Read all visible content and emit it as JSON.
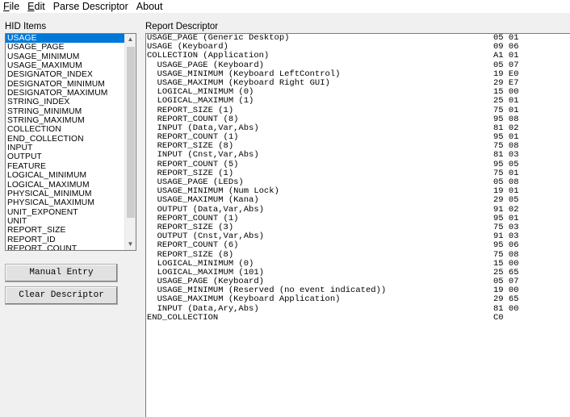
{
  "menubar": {
    "items": [
      {
        "label": "File",
        "ul": "F",
        "rest": "ile"
      },
      {
        "label": "Edit",
        "ul": "E",
        "rest": "dit"
      },
      {
        "label": "Parse Descriptor",
        "ul": "",
        "rest": "Parse Descriptor"
      },
      {
        "label": "About",
        "ul": "",
        "rest": "About"
      }
    ]
  },
  "hid_items": {
    "title": "HID Items",
    "items": [
      "USAGE",
      "USAGE_PAGE",
      "USAGE_MINIMUM",
      "USAGE_MAXIMUM",
      "DESIGNATOR_INDEX",
      "DESIGNATOR_MINIMUM",
      "DESIGNATOR_MAXIMUM",
      "STRING_INDEX",
      "STRING_MINIMUM",
      "STRING_MAXIMUM",
      "COLLECTION",
      "END_COLLECTION",
      "INPUT",
      "OUTPUT",
      "FEATURE",
      "LOGICAL_MINIMUM",
      "LOGICAL_MAXIMUM",
      "PHYSICAL_MINIMUM",
      "PHYSICAL_MAXIMUM",
      "UNIT_EXPONENT",
      "UNIT",
      "REPORT_SIZE",
      "REPORT_ID",
      "REPORT_COUNT"
    ],
    "selected_index": 0,
    "scroll_up_glyph": "▲",
    "scroll_down_glyph": "▼"
  },
  "buttons": {
    "manual_entry": "Manual Entry",
    "clear_descriptor": "Clear Descriptor"
  },
  "report": {
    "title": "Report Descriptor",
    "rows": [
      {
        "desc": "USAGE_PAGE (Generic Desktop)",
        "hex": "05 01"
      },
      {
        "desc": "USAGE (Keyboard)",
        "hex": "09 06"
      },
      {
        "desc": "COLLECTION (Application)",
        "hex": "A1 01"
      },
      {
        "desc": "  USAGE_PAGE (Keyboard)",
        "hex": "05 07"
      },
      {
        "desc": "  USAGE_MINIMUM (Keyboard LeftControl)",
        "hex": "19 E0"
      },
      {
        "desc": "  USAGE_MAXIMUM (Keyboard Right GUI)",
        "hex": "29 E7"
      },
      {
        "desc": "  LOGICAL_MINIMUM (0)",
        "hex": "15 00"
      },
      {
        "desc": "  LOGICAL_MAXIMUM (1)",
        "hex": "25 01"
      },
      {
        "desc": "  REPORT_SIZE (1)",
        "hex": "75 01"
      },
      {
        "desc": "  REPORT_COUNT (8)",
        "hex": "95 08"
      },
      {
        "desc": "  INPUT (Data,Var,Abs)",
        "hex": "81 02"
      },
      {
        "desc": "  REPORT_COUNT (1)",
        "hex": "95 01"
      },
      {
        "desc": "  REPORT_SIZE (8)",
        "hex": "75 08"
      },
      {
        "desc": "  INPUT (Cnst,Var,Abs)",
        "hex": "81 03"
      },
      {
        "desc": "  REPORT_COUNT (5)",
        "hex": "95 05"
      },
      {
        "desc": "  REPORT_SIZE (1)",
        "hex": "75 01"
      },
      {
        "desc": "  USAGE_PAGE (LEDs)",
        "hex": "05 08"
      },
      {
        "desc": "  USAGE_MINIMUM (Num Lock)",
        "hex": "19 01"
      },
      {
        "desc": "  USAGE_MAXIMUM (Kana)",
        "hex": "29 05"
      },
      {
        "desc": "  OUTPUT (Data,Var,Abs)",
        "hex": "91 02"
      },
      {
        "desc": "  REPORT_COUNT (1)",
        "hex": "95 01"
      },
      {
        "desc": "  REPORT_SIZE (3)",
        "hex": "75 03"
      },
      {
        "desc": "  OUTPUT (Cnst,Var,Abs)",
        "hex": "91 03"
      },
      {
        "desc": "  REPORT_COUNT (6)",
        "hex": "95 06"
      },
      {
        "desc": "  REPORT_SIZE (8)",
        "hex": "75 08"
      },
      {
        "desc": "  LOGICAL_MINIMUM (0)",
        "hex": "15 00"
      },
      {
        "desc": "  LOGICAL_MAXIMUM (101)",
        "hex": "25 65"
      },
      {
        "desc": "  USAGE_PAGE (Keyboard)",
        "hex": "05 07"
      },
      {
        "desc": "  USAGE_MINIMUM (Reserved (no event indicated))",
        "hex": "19 00"
      },
      {
        "desc": "  USAGE_MAXIMUM (Keyboard Application)",
        "hex": "29 65"
      },
      {
        "desc": "  INPUT (Data,Ary,Abs)",
        "hex": "81 00"
      },
      {
        "desc": "END_COLLECTION",
        "hex": "C0"
      }
    ]
  },
  "colors": {
    "selection": "#0078d7",
    "window_bg": "#f0f0f0",
    "field_bg": "#ffffff"
  }
}
